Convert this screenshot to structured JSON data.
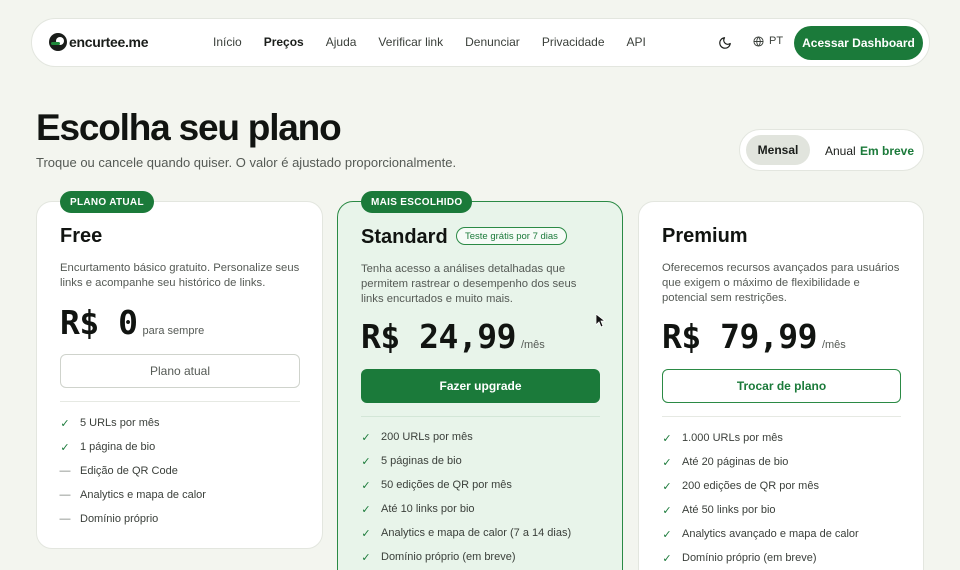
{
  "nav": {
    "logo_text": "encurtee.me",
    "links": [
      "Início",
      "Preços",
      "Ajuda",
      "Verificar link",
      "Denunciar",
      "Privacidade",
      "API"
    ],
    "active_index": 1,
    "theme_icon": "moon-icon",
    "lang_icon": "globe-icon",
    "language": "PT",
    "cta_label": "Acessar Dashboard"
  },
  "hero": {
    "title": "Escolha seu plano",
    "subtitle": "Troque ou cancele quando quiser. O valor é ajustado proporcionalmente."
  },
  "billing_toggle": {
    "monthly_label": "Mensal",
    "annual_label": "Anual",
    "soon_label": "Em breve",
    "selected": "Mensal"
  },
  "plans": [
    {
      "badge": "PLANO ATUAL",
      "name": "Free",
      "description": "Encurtamento básico gratuito. Personalize seus links e acompanhe seu histórico de links.",
      "price": "R$ 0",
      "period": "para sempre",
      "button": "Plano atual",
      "features": [
        {
          "text": "5 URLs por mês",
          "included": true
        },
        {
          "text": "1 página de bio",
          "included": true
        },
        {
          "text": "Edição de QR Code",
          "included": false
        },
        {
          "text": "Analytics e mapa de calor",
          "included": false
        },
        {
          "text": "Domínio próprio",
          "included": false
        }
      ]
    },
    {
      "badge": "MAIS ESCOLHIDO",
      "name": "Standard",
      "trial": "Teste grátis por 7 dias",
      "description": "Tenha acesso a análises detalhadas que permitem rastrear o desempenho dos seus links encurtados e muito mais.",
      "price": "R$ 24,99",
      "period": "/mês",
      "button": "Fazer upgrade",
      "features": [
        {
          "text": "200 URLs por mês",
          "included": true
        },
        {
          "text": "5 páginas de bio",
          "included": true
        },
        {
          "text": "50 edições de QR por mês",
          "included": true
        },
        {
          "text": "Até 10 links por bio",
          "included": true
        },
        {
          "text": "Analytics e mapa de calor (7 a 14 dias)",
          "included": true
        },
        {
          "text": "Domínio próprio (em breve)",
          "included": true
        }
      ]
    },
    {
      "name": "Premium",
      "description": "Oferecemos recursos avançados para usuários que exigem o máximo de flexibilidade e potencial sem restrições.",
      "price": "R$ 79,99",
      "period": "/mês",
      "button": "Trocar de plano",
      "features": [
        {
          "text": "1.000 URLs por mês",
          "included": true
        },
        {
          "text": "Até 20 páginas de bio",
          "included": true
        },
        {
          "text": "200 edições de QR por mês",
          "included": true
        },
        {
          "text": "Até 50 links por bio",
          "included": true
        },
        {
          "text": "Analytics avançado e mapa de calor",
          "included": true
        },
        {
          "text": "Domínio próprio (em breve)",
          "included": true
        }
      ]
    }
  ],
  "colors": {
    "brand_green": "#1b7a3a",
    "page_bg": "#f3f5ef",
    "featured_bg": "#e8f4ea"
  }
}
